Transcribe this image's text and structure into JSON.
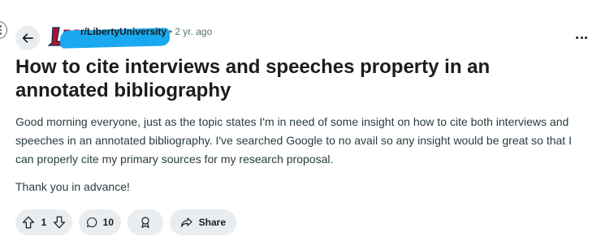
{
  "post": {
    "subreddit": "r/LibertyUniversity",
    "separator": "•",
    "time_ago": "2 yr. ago",
    "title": "How to cite interviews and speeches property in an annotated bibliography",
    "body_paragraphs": [
      "Good morning everyone, just as the topic states I'm in need of some insight on how to cite both interviews and speeches in an annotated bibliography. I've searched Google to no avail so any insight would be great so that I can properly cite my primary sources for my research proposal.",
      "Thank you in advance!"
    ]
  },
  "actions": {
    "vote_count": "1",
    "comment_count": "10",
    "share_label": "Share"
  },
  "icons": {
    "back": "arrow-left-icon",
    "logo": "liberty-university-logo",
    "overflow": "more-horizontal-icon",
    "upvote": "arrow-up-icon",
    "downvote": "arrow-down-icon",
    "comment": "speech-bubble-icon",
    "award": "award-icon",
    "share": "share-arrow-icon"
  },
  "colors": {
    "pill_background": "#eaedef",
    "meta_gray": "#576f76",
    "logo_red": "#b3132c",
    "logo_navy": "#0b2a52",
    "redaction_blue": "#1aa9f0"
  }
}
